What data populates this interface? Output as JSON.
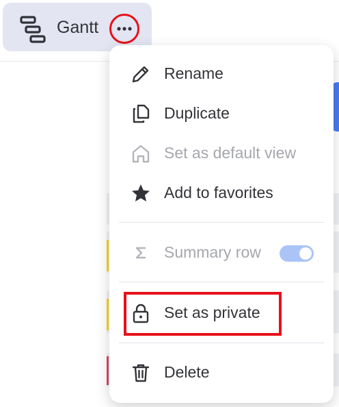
{
  "view_tab": {
    "label": "Gantt",
    "icon": "gantt-icon",
    "more_icon": "ellipsis-icon"
  },
  "menu": {
    "items": [
      {
        "label": "Rename",
        "icon": "pencil-icon",
        "disabled": false
      },
      {
        "label": "Duplicate",
        "icon": "duplicate-icon",
        "disabled": false
      },
      {
        "label": "Set as default view",
        "icon": "home-icon",
        "disabled": true
      },
      {
        "label": "Add to favorites",
        "icon": "star-icon",
        "disabled": false
      },
      {
        "label": "Summary row",
        "icon": "sigma-icon",
        "disabled": true,
        "toggle_on": true
      },
      {
        "label": "Set as private",
        "icon": "lock-icon",
        "disabled": false,
        "highlighted": true
      },
      {
        "label": "Delete",
        "icon": "trash-icon",
        "disabled": false
      }
    ]
  },
  "colors": {
    "highlight": "#e8101a",
    "accent": "#4a7cf0",
    "toggle": "#aac4f7",
    "text": "#323338",
    "disabled_text": "#a6a7ae"
  }
}
